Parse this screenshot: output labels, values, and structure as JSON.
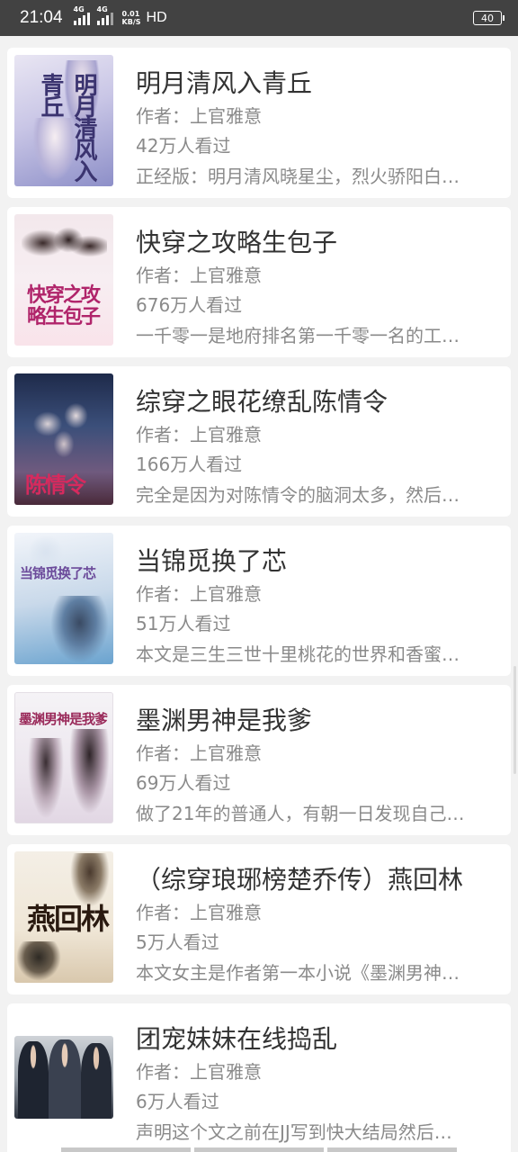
{
  "status": {
    "time": "21:04",
    "sim1": "4G",
    "sim2": "4G",
    "net_speed": "0.01",
    "net_unit": "KB/S",
    "hd": "HD",
    "battery": "40"
  },
  "books": [
    {
      "title": "明月清风入青丘",
      "author": "作者：上官雅意",
      "views": "42万人看过",
      "desc": "正经版：明月清风晓星尘，烈火骄阳白…",
      "cover_text": "明月清风入青丘"
    },
    {
      "title": "快穿之攻略生包子",
      "author": "作者：上官雅意",
      "views": "676万人看过",
      "desc": "一千零一是地府排名第一千零一名的工…",
      "cover_text": "快穿之攻略生包子"
    },
    {
      "title": "综穿之眼花缭乱陈情令",
      "author": "作者：上官雅意",
      "views": "166万人看过",
      "desc": "完全是因为对陈情令的脑洞太多，然后…",
      "cover_text": "陈情令"
    },
    {
      "title": "当锦觅换了芯",
      "author": "作者：上官雅意",
      "views": "51万人看过",
      "desc": "本文是三生三世十里桃花的世界和香蜜…",
      "cover_text": "当锦觅换了芯"
    },
    {
      "title": "墨渊男神是我爹",
      "author": "作者：上官雅意",
      "views": "69万人看过",
      "desc": "做了21年的普通人，有朝一日发现自己…",
      "cover_text": "墨渊男神是我爹"
    },
    {
      "title": "（综穿琅琊榜楚乔传）燕回林",
      "author": "作者：上官雅意",
      "views": "5万人看过",
      "desc": "本文女主是作者第一本小说《墨渊男神…",
      "cover_text": "燕回林"
    },
    {
      "title": "团宠妹妹在线捣乱",
      "author": "作者：上官雅意",
      "views": "6万人看过",
      "desc": "声明这个文之前在JJ写到快大结局然后…",
      "cover_text": ""
    }
  ],
  "colors": {
    "background": "#f2f2f2",
    "card": "#ffffff",
    "title": "#333333",
    "meta": "#8a8a8a",
    "statusbar": "#424242"
  }
}
